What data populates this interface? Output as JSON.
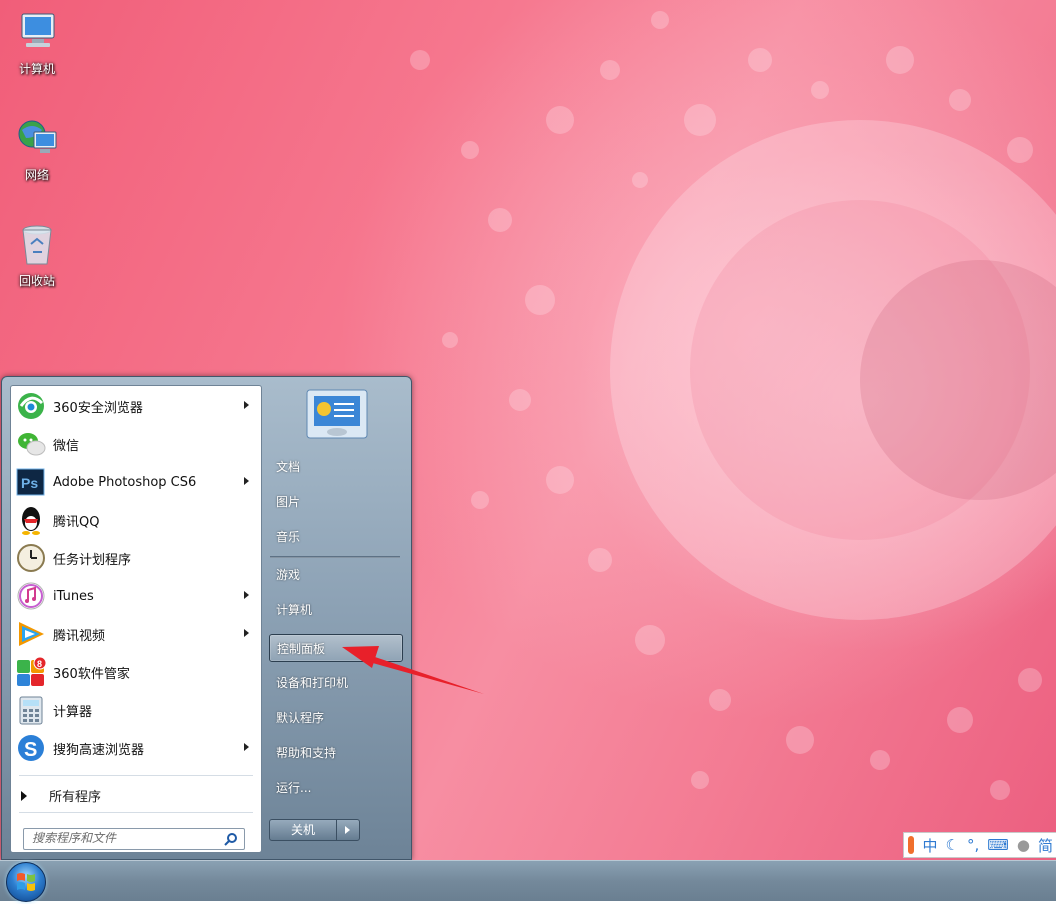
{
  "desktop": {
    "icons": [
      {
        "label": "计算机",
        "icon": "computer-icon"
      },
      {
        "label": "网络",
        "icon": "network-icon"
      },
      {
        "label": "回收站",
        "icon": "recycle-bin-icon"
      }
    ]
  },
  "start_menu": {
    "programs": [
      {
        "label": "360安全浏览器",
        "icon": "360-browser-icon",
        "has_submenu": true
      },
      {
        "label": "微信",
        "icon": "wechat-icon",
        "has_submenu": false
      },
      {
        "label": "Adobe Photoshop CS6",
        "icon": "photoshop-icon",
        "icon_text": "Ps",
        "has_submenu": true
      },
      {
        "label": "腾讯QQ",
        "icon": "qq-penguin-icon",
        "has_submenu": false
      },
      {
        "label": "任务计划程序",
        "icon": "clock-icon",
        "has_submenu": false
      },
      {
        "label": "iTunes",
        "icon": "itunes-icon",
        "has_submenu": true
      },
      {
        "label": "腾讯视频",
        "icon": "tencent-video-icon",
        "has_submenu": true
      },
      {
        "label": "360软件管家",
        "icon": "360-software-manager-icon",
        "badge": "8",
        "has_submenu": false
      },
      {
        "label": "计算器",
        "icon": "calculator-icon",
        "has_submenu": false
      },
      {
        "label": "搜狗高速浏览器",
        "icon": "sogou-browser-icon",
        "has_submenu": true
      }
    ],
    "all_programs_label": "所有程序",
    "search": {
      "placeholder": "搜索程序和文件"
    },
    "places": [
      {
        "label": "文档"
      },
      {
        "label": "图片"
      },
      {
        "label": "音乐"
      },
      {
        "label": "游戏"
      },
      {
        "label": "计算机"
      },
      {
        "label": "控制面板"
      },
      {
        "label": "设备和打印机"
      },
      {
        "label": "默认程序"
      },
      {
        "label": "帮助和支持"
      },
      {
        "label": "运行..."
      }
    ],
    "highlighted_place": "控制面板",
    "shutdown_label": "关机"
  },
  "ime": {
    "mode": "中",
    "lang": "简"
  },
  "colors": {
    "annotation_arrow": "#e8202a",
    "highlight_border": "#2c3e4f"
  }
}
